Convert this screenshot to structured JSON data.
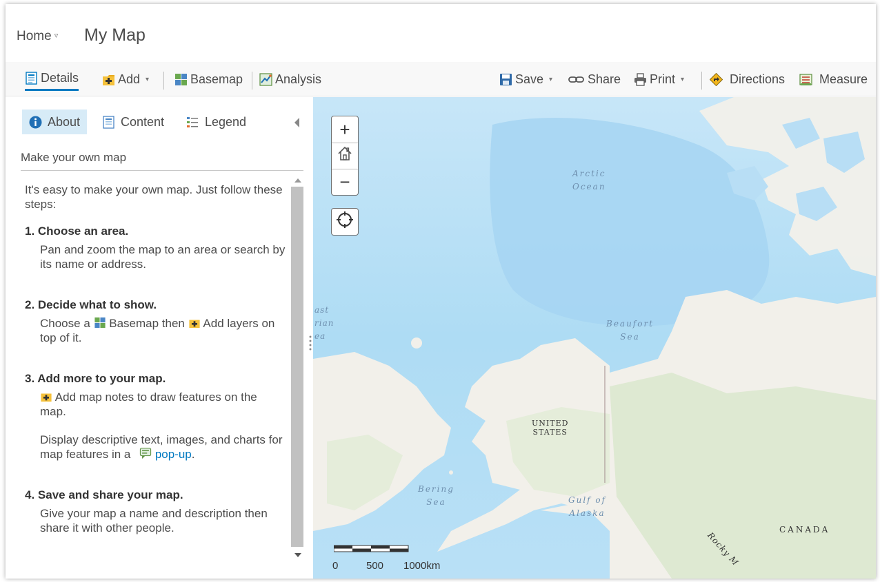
{
  "header": {
    "home_label": "Home",
    "home_caret": "▿",
    "title": "My Map"
  },
  "toolbar": {
    "details": "Details",
    "add": "Add",
    "basemap": "Basemap",
    "analysis": "Analysis",
    "save": "Save",
    "share": "Share",
    "print": "Print",
    "directions": "Directions",
    "measure": "Measure",
    "dropdown_caret": "▾"
  },
  "panel": {
    "tabs": [
      {
        "label": "About",
        "icon": "info-icon",
        "active": true
      },
      {
        "label": "Content",
        "icon": "content-icon",
        "active": false
      },
      {
        "label": "Legend",
        "icon": "legend-icon",
        "active": false
      }
    ],
    "subtitle": "Make your own map",
    "intro": "It's easy to make your own map. Just follow these steps:",
    "steps": [
      {
        "title": "1. Choose an area.",
        "body": "Pan and zoom the map to an area or search by its name or address."
      },
      {
        "title": "2. Decide what to show.",
        "body_a": "Choose a",
        "body_b": "Basemap then",
        "body_c": "Add layers on top of it."
      },
      {
        "title": "3. Add more to your map.",
        "body": "Add map notes to draw features on the map.",
        "body2": "Display descriptive text, images, and charts for map features in a",
        "link": "pop-up",
        "period": "."
      },
      {
        "title": "4. Save and share your map.",
        "body": "Give your map a name and description then share it with other people."
      }
    ]
  },
  "map": {
    "controls": {
      "zoom_in": "+",
      "zoom_out": "−"
    },
    "labels": {
      "arctic_1": "Arctic",
      "arctic_2": "Ocean",
      "beaufort_1": "Beaufort",
      "beaufort_2": "Sea",
      "bering_1": "Bering",
      "bering_2": "Sea",
      "gulf_1": "Gulf of",
      "gulf_2": "Alaska",
      "us_1": "UNITED",
      "us_2": "STATES",
      "canada": "CANADA",
      "rocky": "Rocky M",
      "east_siberian_1": "ast",
      "east_siberian_2": "rian",
      "east_siberian_3": "ea"
    },
    "scale": {
      "zero": "0",
      "mid": "500",
      "end": "1000km"
    }
  },
  "colors": {
    "accent": "#0079c1",
    "ocean": "#b8def5",
    "deep_ocean": "#a9d6f3",
    "land": "#f2f0ea",
    "forest": "#dbe8cf"
  }
}
